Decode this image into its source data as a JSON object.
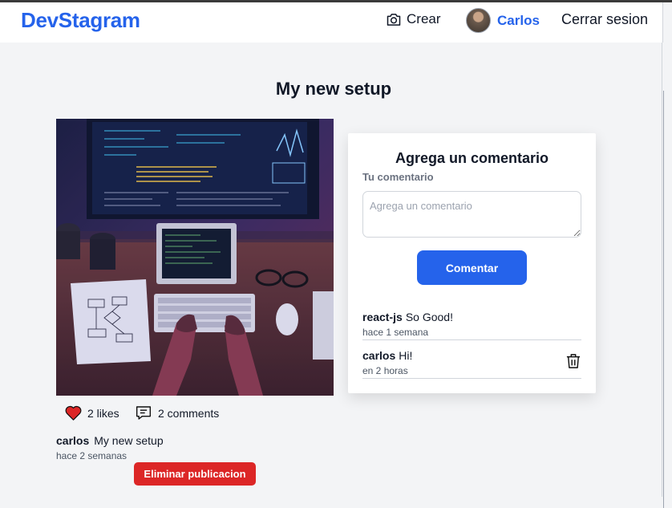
{
  "header": {
    "logo": "DevStagram",
    "crear_label": "Crear",
    "user_name": "Carlos",
    "logout_label": "Cerrar sesion"
  },
  "post": {
    "title": "My new setup",
    "likes_label": "2 likes",
    "comments_label": "2 comments",
    "author": "carlos",
    "caption": "My new setup",
    "time": "hace 2 semanas",
    "delete_label": "Eliminar publicacion"
  },
  "comment_form": {
    "title": "Agrega un comentario",
    "label": "Tu comentario",
    "placeholder": "Agrega un comentario",
    "submit_label": "Comentar"
  },
  "comments": [
    {
      "user": "react-js",
      "text": "So Good!",
      "time": "hace 1 semana"
    },
    {
      "user": "carlos",
      "text": "Hi!",
      "time": "en 2 horas"
    }
  ],
  "colors": {
    "brand": "#2563eb",
    "danger": "#dc2626",
    "heart": "#dc2626"
  }
}
